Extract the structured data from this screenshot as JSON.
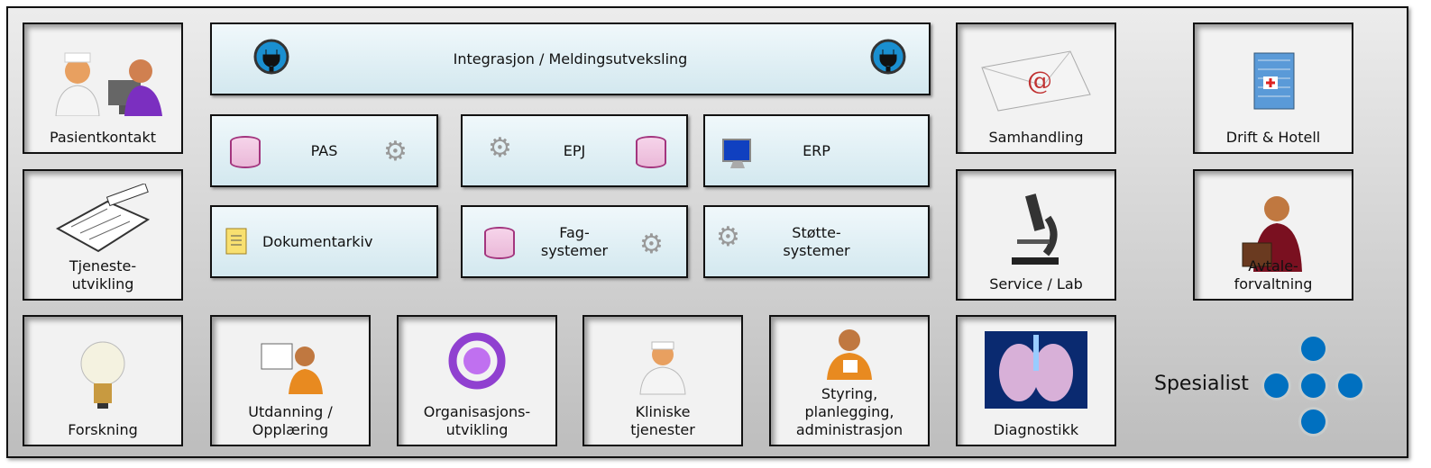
{
  "integration": {
    "label": "Integrasjon / Meldingsutveksling",
    "icon": "plug-icon"
  },
  "systems": [
    {
      "label": "PAS",
      "icons": [
        "database-icon",
        "gears-icon"
      ]
    },
    {
      "label": "EPJ",
      "icons": [
        "gears-icon",
        "database-icon"
      ]
    },
    {
      "label": "ERP",
      "icons": [
        "monitor-icon"
      ]
    },
    {
      "label": "Dokumentarkiv",
      "icons": [
        "document-icon"
      ]
    },
    {
      "label": "Fag-\nsystemer",
      "icons": [
        "database-icon",
        "gears-icon"
      ]
    },
    {
      "label": "Støtte-\nsystemer",
      "icons": [
        "gears-icon"
      ]
    }
  ],
  "tiles": {
    "pasientkontakt": "Pasientkontakt",
    "tjenesteutvikling": "Tjeneste-\nutvikling",
    "forskning": "Forskning",
    "utdanning": "Utdanning /\nOpplæring",
    "organisasjon": "Organisasjons-\nutvikling",
    "kliniske": "Kliniske\ntjenester",
    "styring": "Styring,\nplanlegging,\nadministrasjon",
    "diagnostikk": "Diagnostikk",
    "samhandling": "Samhandling",
    "service": "Service / Lab",
    "drift": "Drift & Hotell",
    "avtale": "Avtale-\nforvaltning"
  },
  "specialist": {
    "label": "Spesialist",
    "dot_color": "#0070c0"
  }
}
